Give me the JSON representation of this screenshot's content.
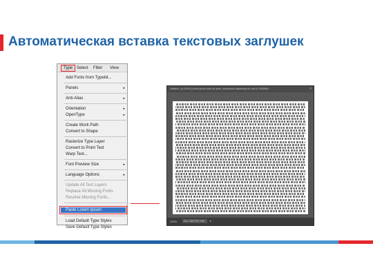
{
  "slide": {
    "title": "Автоматическая вставка текстовых заглушек"
  },
  "menubar": {
    "items": [
      "Type",
      "Select",
      "Filter",
      "View"
    ]
  },
  "menu": {
    "items": [
      {
        "label": "Add Fonts from Typekit...",
        "disabled": false,
        "arrow": ""
      },
      {
        "label": "Panels",
        "disabled": false,
        "arrow": "▸"
      },
      {
        "label": "Anti-Alias",
        "disabled": false,
        "arrow": "▸"
      },
      {
        "label": "Orientation",
        "disabled": false,
        "arrow": "▸"
      },
      {
        "label": "OpenType",
        "disabled": false,
        "arrow": "▸"
      },
      {
        "label": "Create Work Path",
        "disabled": false,
        "arrow": ""
      },
      {
        "label": "Convert to Shape",
        "disabled": false,
        "arrow": ""
      },
      {
        "label": "Rasterize Type Layer",
        "disabled": false,
        "arrow": ""
      },
      {
        "label": "Convert to Point Text",
        "disabled": false,
        "arrow": ""
      },
      {
        "label": "Warp Text...",
        "disabled": false,
        "arrow": ""
      },
      {
        "label": "Font Preview Size",
        "disabled": false,
        "arrow": "▸"
      },
      {
        "label": "Language Options",
        "disabled": false,
        "arrow": "▸"
      },
      {
        "label": "Update All Text Layers",
        "disabled": true,
        "arrow": ""
      },
      {
        "label": "Replace All Missing Fonts",
        "disabled": true,
        "arrow": ""
      },
      {
        "label": "Resolve Missing Fonts...",
        "disabled": true,
        "arrow": ""
      },
      {
        "label": "Paste Lorem Ipsum",
        "disabled": false,
        "arrow": "",
        "selected": true
      },
      {
        "label": "Load Default Type Styles",
        "disabled": false,
        "arrow": ""
      },
      {
        "label": "Save Default Type Styles",
        "disabled": false,
        "arrow": ""
      }
    ]
  },
  "document": {
    "title": "Untitled-1 @ 100% (Lorem ipsum dolor sit amet, consectetur adipiscing elit, sed d, RGB/8#) *",
    "close": "×",
    "zoom": "100%",
    "doc_info": "Doc: 445.7K/2.14M",
    "status_arrow": "▸"
  },
  "colors": {
    "accent": "#e3262b",
    "title": "#1f63a6",
    "highlight": "#3a73c4",
    "stripes": [
      "#6fb6e3",
      "#1f63a6",
      "#4a97d3",
      "#e3262b"
    ]
  }
}
